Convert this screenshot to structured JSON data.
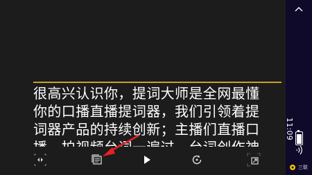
{
  "teleprompter": {
    "lines": [
      "很高兴认识你，提词大师是全网最懂",
      "你的口播直播提词器，我们引领着提",
      "词器产品的持续创新；主播们直播口",
      "播、拍视频台词一遍过，台词创作神"
    ]
  },
  "colors": {
    "background": "#1c1c1c",
    "guide_line": "#c9a227",
    "annotation_arrow": "#e8202a",
    "system_bar": "#0f0a2a"
  },
  "toolbar": {
    "icons": [
      "mirror-flip-icon",
      "script-list-icon",
      "play-icon",
      "rotate-icon",
      "resize-icon"
    ]
  },
  "system": {
    "time": "11:09",
    "battery_level": 0.8,
    "badge": "三联"
  }
}
